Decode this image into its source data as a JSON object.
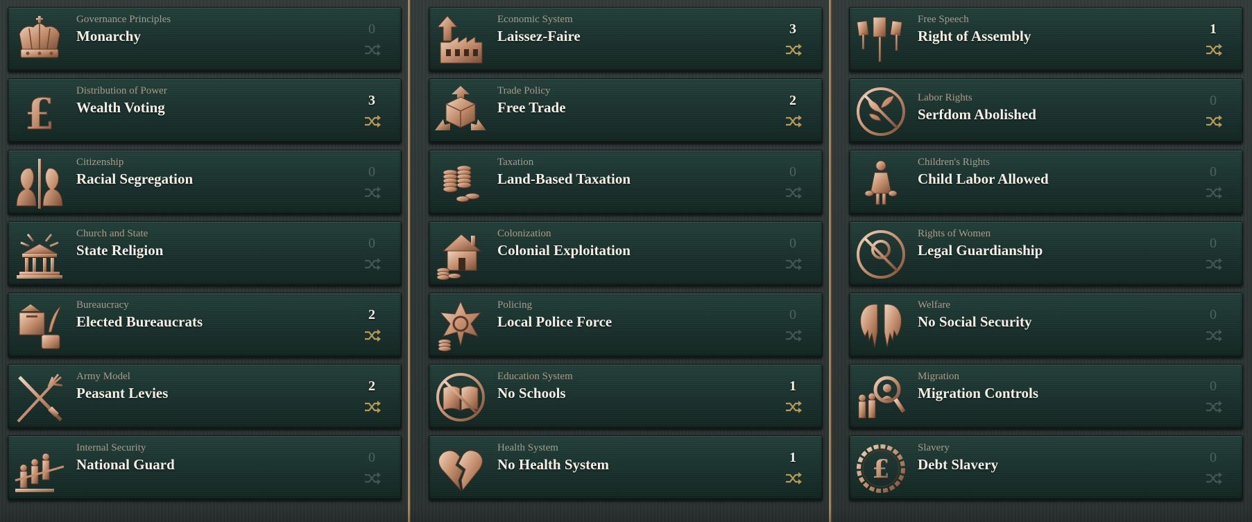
{
  "colors": {
    "bronze": "#c89a78",
    "panel": "#1c3430",
    "active_count": "#f7f2e8",
    "zero_count": "#4f625d",
    "gold_shuffle": "#b89a55"
  },
  "columns": [
    {
      "laws": [
        {
          "group": "Governance Principles",
          "name": "Monarchy",
          "count": "0",
          "icon": "crown-icon"
        },
        {
          "group": "Distribution of Power",
          "name": "Wealth Voting",
          "count": "3",
          "icon": "pound-sign-icon"
        },
        {
          "group": "Citizenship",
          "name": "Racial Segregation",
          "count": "0",
          "icon": "segregated-busts-icon"
        },
        {
          "group": "Church and State",
          "name": "State Religion",
          "count": "0",
          "icon": "temple-icon"
        },
        {
          "group": "Bureaucracy",
          "name": "Elected Bureaucrats",
          "count": "2",
          "icon": "ballot-box-quill-icon"
        },
        {
          "group": "Army Model",
          "name": "Peasant Levies",
          "count": "2",
          "icon": "pitchfork-musket-icon"
        },
        {
          "group": "Internal Security",
          "name": "National Guard",
          "count": "0",
          "icon": "marching-soldiers-icon"
        }
      ]
    },
    {
      "laws": [
        {
          "group": "Economic System",
          "name": "Laissez-Faire",
          "count": "3",
          "icon": "factory-arrow-icon"
        },
        {
          "group": "Trade Policy",
          "name": "Free Trade",
          "count": "2",
          "icon": "crate-arrows-icon"
        },
        {
          "group": "Taxation",
          "name": "Land-Based Taxation",
          "count": "0",
          "icon": "coin-stacks-icon"
        },
        {
          "group": "Colonization",
          "name": "Colonial Exploitation",
          "count": "0",
          "icon": "house-coins-icon"
        },
        {
          "group": "Policing",
          "name": "Local Police Force",
          "count": "0",
          "icon": "sheriff-star-icon"
        },
        {
          "group": "Education System",
          "name": "No Schools",
          "count": "1",
          "icon": "crossed-book-icon"
        },
        {
          "group": "Health System",
          "name": "No Health System",
          "count": "1",
          "icon": "broken-heart-icon"
        }
      ]
    },
    {
      "laws": [
        {
          "group": "Free Speech",
          "name": "Right of Assembly",
          "count": "1",
          "icon": "protest-signs-icon"
        },
        {
          "group": "Labor Rights",
          "name": "Serfdom Abolished",
          "count": "0",
          "icon": "crossed-plant-icon"
        },
        {
          "group": "Children's Rights",
          "name": "Child Labor Allowed",
          "count": "0",
          "icon": "child-worker-icon"
        },
        {
          "group": "Rights of Women",
          "name": "Legal Guardianship",
          "count": "0",
          "icon": "crossed-venus-icon"
        },
        {
          "group": "Welfare",
          "name": "No Social Security",
          "count": "0",
          "icon": "torn-wings-icon"
        },
        {
          "group": "Migration",
          "name": "Migration Controls",
          "count": "0",
          "icon": "magnifier-migrants-icon"
        },
        {
          "group": "Slavery",
          "name": "Debt Slavery",
          "count": "0",
          "icon": "chained-pound-icon"
        }
      ]
    }
  ]
}
